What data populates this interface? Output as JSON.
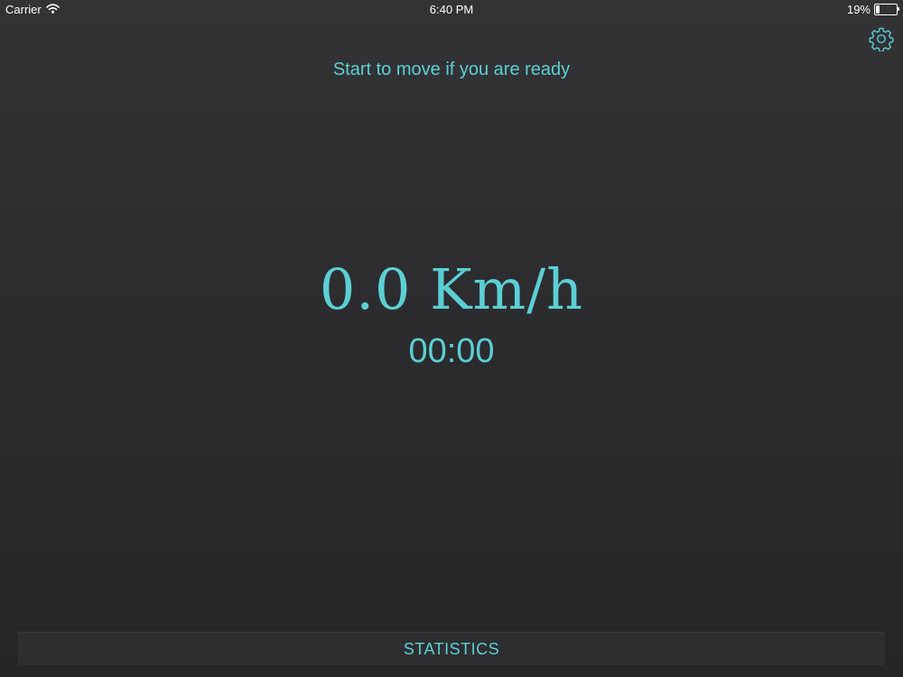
{
  "status_bar": {
    "carrier": "Carrier",
    "time": "6:40 PM",
    "battery_percent": "19%",
    "battery_level": 0.19
  },
  "main": {
    "prompt": "Start to move if you are ready",
    "speed": "0.0 Km/h",
    "timer": "00:00"
  },
  "footer": {
    "statistics_label": "STATISTICS"
  },
  "icons": {
    "settings": "gear-icon",
    "wifi": "wifi-icon",
    "battery": "battery-icon"
  },
  "colors": {
    "accent": "#5ccfd4",
    "background": "#2b2b2d",
    "status_text": "#ffffff"
  }
}
